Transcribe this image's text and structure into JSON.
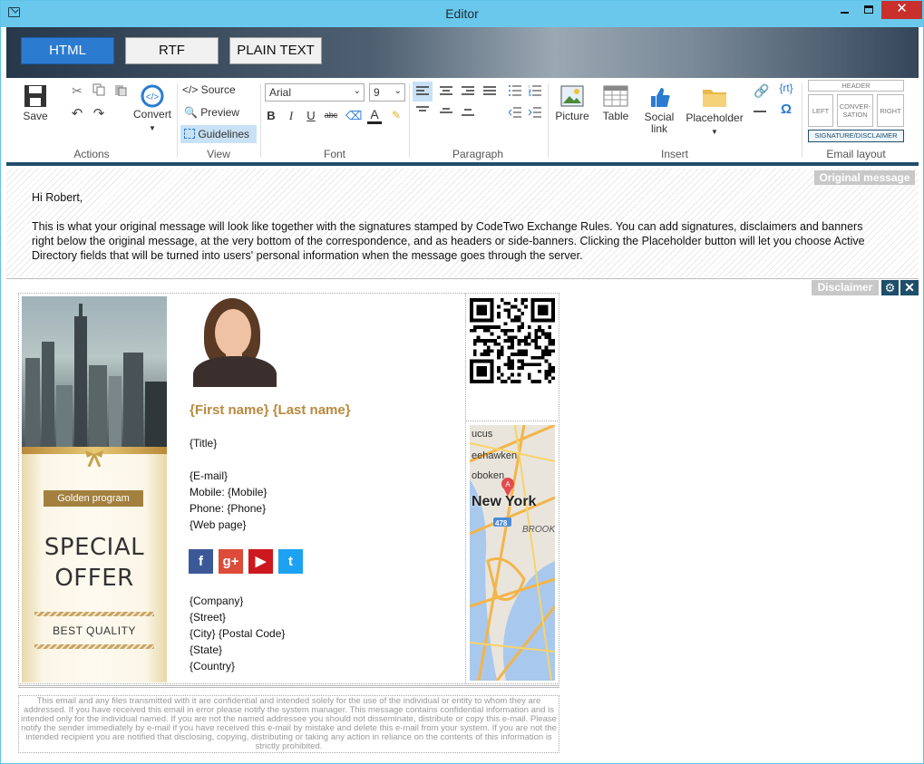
{
  "window": {
    "title": "Editor"
  },
  "modes": {
    "html": "HTML",
    "rtf": "RTF",
    "plain": "PLAIN TEXT"
  },
  "ribbon": {
    "actions": {
      "save": "Save",
      "convert": "Convert",
      "label": "Actions"
    },
    "view": {
      "source": "</> Source",
      "preview": "Preview",
      "guidelines": "Guidelines",
      "label": "View"
    },
    "font": {
      "family": "Arial",
      "size": "9",
      "label": "Font"
    },
    "paragraph": {
      "label": "Paragraph"
    },
    "insert": {
      "picture": "Picture",
      "table": "Table",
      "social_line1": "Social",
      "social_line2": "link",
      "placeholder": "Placeholder",
      "rt": "{rt}",
      "omega": "Ω",
      "label": "Insert"
    },
    "layout": {
      "header": "HEADER",
      "left": "LEFT",
      "conv1": "CONVER-",
      "conv2": "SATION",
      "right": "RIGHT",
      "sig": "SIGNATURE/DISCLAIMER",
      "label": "Email layout"
    }
  },
  "original": {
    "label": "Original message",
    "greeting": "Hi Robert,",
    "line1": "This is what your original message will look like together with the signatures stamped by CodeTwo Exchange Rules. You can add signatures, disclaimers and banners",
    "line2": "right below the original message, at the very bottom of the correspondence, and as headers or side-banners. Clicking the Placeholder button will let you choose Active",
    "line3": "Directory fields that will be turned into users' personal information when the message goes through the server."
  },
  "disclaimer": {
    "label": "Disclaimer"
  },
  "banner": {
    "golden": "Golden program",
    "special1": "SPECIAL",
    "special2": "OFFER",
    "best": "BEST QUALITY"
  },
  "signature": {
    "name": "{First name} {Last name}",
    "title": "{Title}",
    "email": "{E-mail}",
    "mobile": "Mobile: {Mobile}",
    "phone": "Phone: {Phone}",
    "web": "{Web page}",
    "company": "{Company}",
    "street": "{Street}",
    "city": "{City} {Postal Code}",
    "state": "{State}",
    "country": "{Country}",
    "social": [
      {
        "icon": "facebook-icon",
        "glyph": "f",
        "color": "#3b5998"
      },
      {
        "icon": "google-plus-icon",
        "glyph": "g+",
        "color": "#dd4b39"
      },
      {
        "icon": "youtube-icon",
        "glyph": "▶",
        "color": "#cc181e"
      },
      {
        "icon": "twitter-icon",
        "glyph": "t",
        "color": "#1da1f2"
      }
    ]
  },
  "map": {
    "label1": "New York",
    "label2": "ucus",
    "label3": "eehawken",
    "label4": "oboken",
    "label5": "BROOK",
    "shield": "478"
  },
  "footer": {
    "text": "This email and any files transmitted with it are confidential and intended solely for the use of the individual or entity to whom they are addressed. If you have received this email in error please notify the system manager. This message contains confidential information and is intended only for the individual named. If you are not the named addressee you should not disseminate, distribute or copy this e-mail. Please notify the sender immediately by e-mail if you have received this e-mail by mistake and delete this e-mail from your system. If you are not the intended recipient you are notified that disclosing, copying, distributing or taking any action in reliance on the contents of this information is strictly prohibited."
  },
  "colors": {
    "accent": "#2b7bd0",
    "gold": "#b9893e",
    "dark": "#1f4e6b"
  }
}
